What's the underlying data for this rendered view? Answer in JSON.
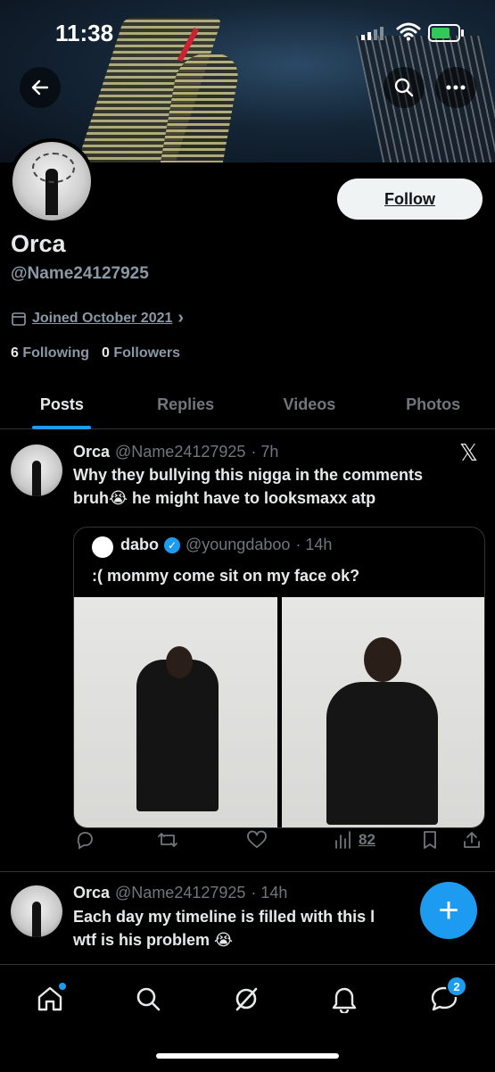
{
  "status_bar": {
    "time": "11:38"
  },
  "profile": {
    "name": "Orca",
    "handle": "@Name24127925",
    "joined": "Joined October 2021",
    "follow_label": "Follow",
    "following_count": "6",
    "following_label": "Following",
    "followers_count": "0",
    "followers_label": "Followers"
  },
  "tabs": [
    {
      "label": "Posts",
      "active": true
    },
    {
      "label": "Replies",
      "active": false
    },
    {
      "label": "Videos",
      "active": false
    },
    {
      "label": "Photos",
      "active": false
    }
  ],
  "posts": [
    {
      "author": "Orca",
      "handle": "@Name24127925",
      "time": "· 7h",
      "text_line1": "Why they bullying this nigga in the comments",
      "text_line2": "bruh😭 he might have to looksmaxx atp",
      "quote": {
        "author": "dabo",
        "handle": "@youngdaboo",
        "time": "· 14h",
        "text": ":( mommy come sit on my face ok?"
      },
      "views": "82"
    },
    {
      "author": "Orca",
      "handle": "@Name24127925",
      "time": "· 14h",
      "text_line1": "Each day my timeline is filled with this l",
      "text_line2": "wtf is his problem 😭"
    }
  ],
  "nav": {
    "messages_badge": "2"
  },
  "colors": {
    "accent": "#1d9bf0",
    "background": "#000000",
    "muted": "#71767b"
  }
}
